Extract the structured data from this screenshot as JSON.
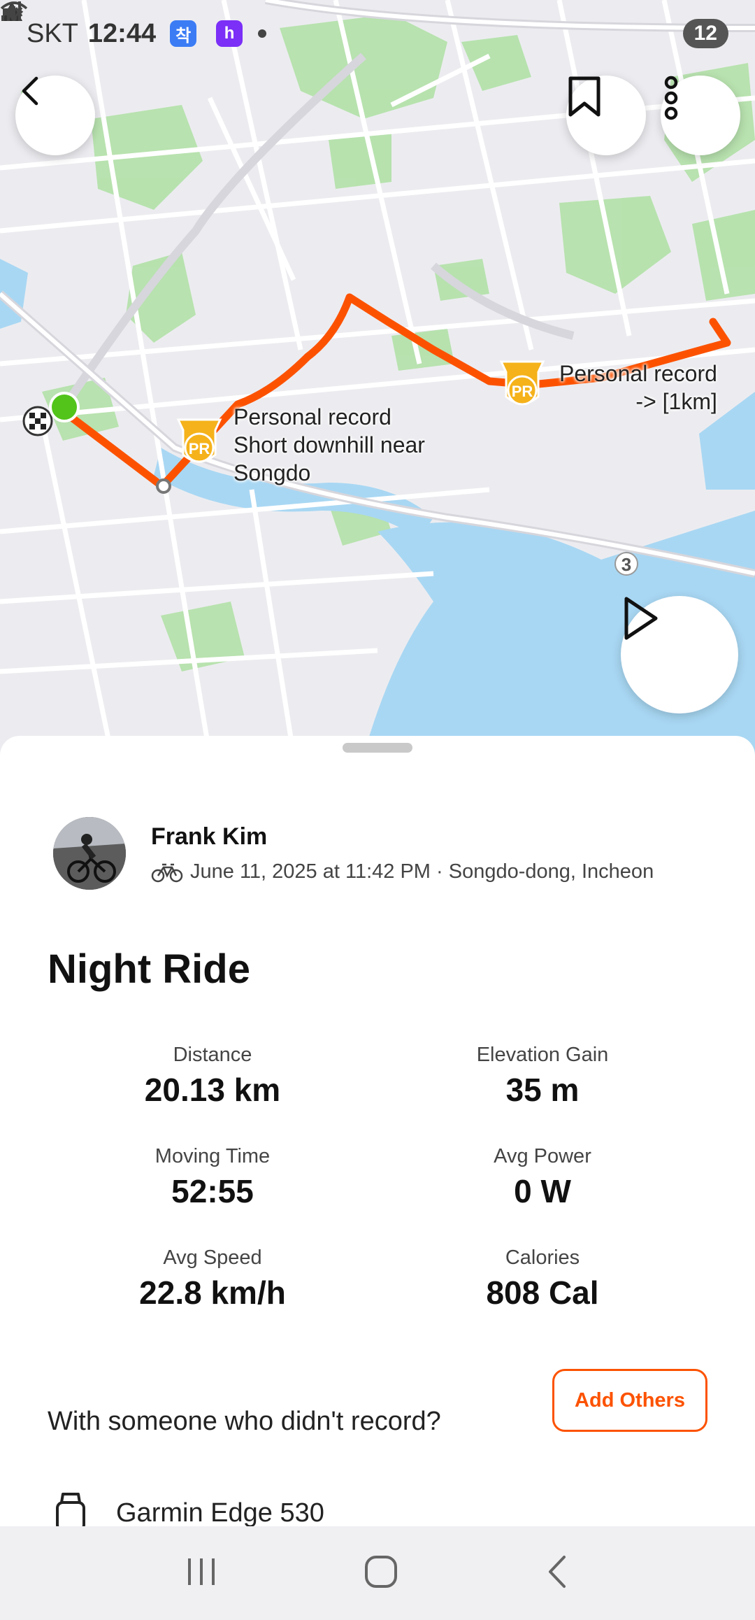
{
  "status_bar": {
    "carrier": "SKT",
    "time": "12:44",
    "badge_1": "착",
    "badge_2": "h",
    "battery": "12"
  },
  "map": {
    "pr_labels": [
      "Personal record\nShort downhill near\nSongdo",
      "Personal record\n->         [1km]"
    ],
    "route_number": "3",
    "route_color": "#fc5200",
    "pr_badge": "PR"
  },
  "athlete": {
    "name": "Frank Kim",
    "meta": "June 11, 2025 at 11:42 PM · Songdo-dong, Incheon"
  },
  "activity": {
    "title": "Night Ride",
    "stats": [
      {
        "label": "Distance",
        "value": "20.13 km"
      },
      {
        "label": "Elevation Gain",
        "value": "35 m"
      },
      {
        "label": "Moving Time",
        "value": "52:55"
      },
      {
        "label": "Avg Power",
        "value": "0 W"
      },
      {
        "label": "Avg Speed",
        "value": "22.8 km/h"
      },
      {
        "label": "Calories",
        "value": "808 Cal"
      }
    ]
  },
  "others": {
    "prompt": "With someone who didn't record?",
    "button": "Add Others"
  },
  "device": {
    "name": "Garmin Edge 530"
  },
  "colors": {
    "accent": "#fc5200",
    "water": "#a8d7f3",
    "park": "#a9e0a0"
  }
}
